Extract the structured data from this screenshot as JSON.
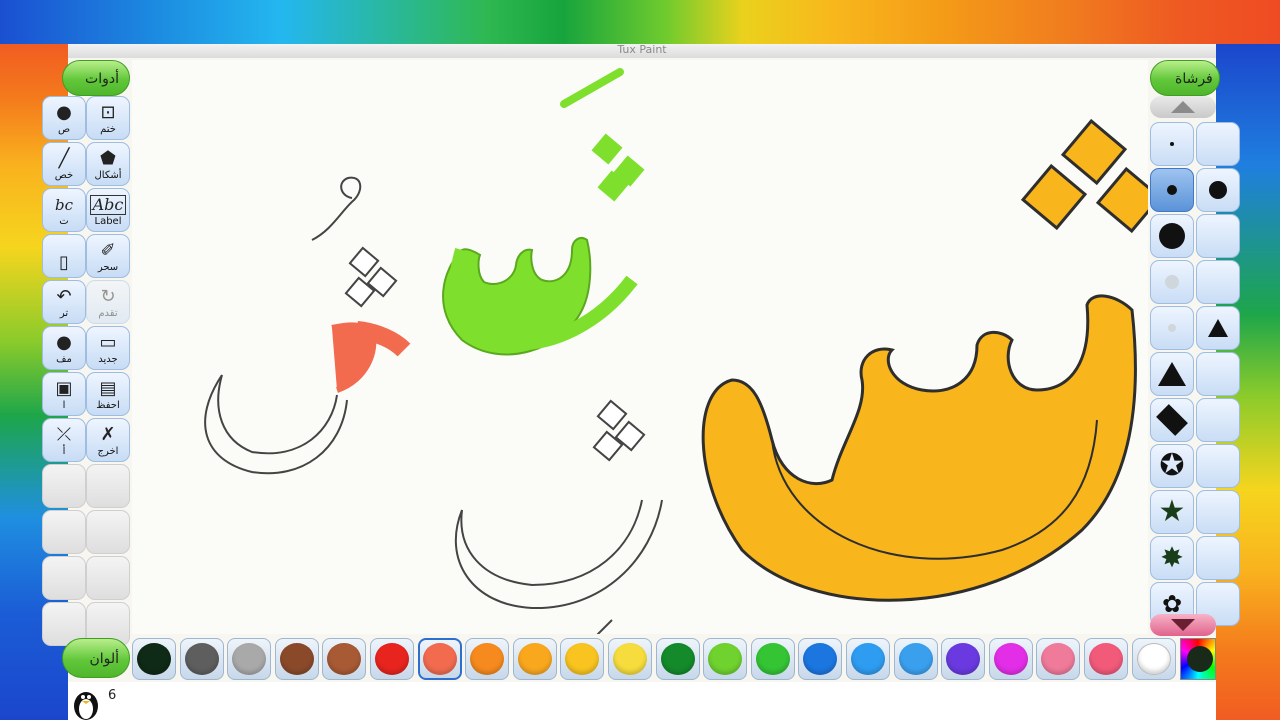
{
  "window": {
    "title": "Tux Paint"
  },
  "tools_panel": {
    "header": "أدوات",
    "tools": [
      {
        "label": "ختم",
        "icon": "stamp-icon",
        "glyph": "⊡",
        "enabled": true
      },
      {
        "label": "أشكال",
        "icon": "shapes-icon",
        "glyph": "⬟",
        "enabled": true
      },
      {
        "label": "Label",
        "icon": "label-icon",
        "glyph": "Abc",
        "enabled": true
      },
      {
        "label": "سحر",
        "icon": "magic-icon",
        "glyph": "✐",
        "enabled": true
      },
      {
        "label": "تقدم",
        "icon": "redo-icon",
        "glyph": "↻",
        "enabled": false
      },
      {
        "label": "جديد",
        "icon": "new-icon",
        "glyph": "▭",
        "enabled": true
      },
      {
        "label": "احفظ",
        "icon": "save-icon",
        "glyph": "▤",
        "enabled": true
      },
      {
        "label": "اخرج",
        "icon": "quit-icon",
        "glyph": "✗",
        "enabled": true
      }
    ],
    "left_column_fragments": [
      {
        "label": "ص",
        "icon": "paint-icon"
      },
      {
        "label": "خص",
        "icon": "lines-icon"
      },
      {
        "label": "ت",
        "icon": "text-icon"
      },
      {
        "label": "",
        "icon": "eraser-icon"
      },
      {
        "label": "تر",
        "icon": "undo-icon"
      },
      {
        "label": "مف",
        "icon": "open-icon"
      },
      {
        "label": "ا",
        "icon": "print-icon"
      },
      {
        "label": "أ",
        "icon": "exit-icon"
      }
    ]
  },
  "brush_panel": {
    "header": "فرشاة",
    "scroll_up": "scroll-up-arrow",
    "scroll_down": "scroll-down-arrow",
    "brushes": [
      {
        "icon": "brush-tiny-dot",
        "selected": false
      },
      {
        "icon": "brush-small-dot",
        "selected": true
      },
      {
        "icon": "brush-large-dot",
        "selected": false
      },
      {
        "icon": "brush-soft-dot",
        "selected": false
      },
      {
        "icon": "brush-faint-dot",
        "selected": false
      },
      {
        "icon": "brush-triangle",
        "selected": false
      },
      {
        "icon": "brush-diamond",
        "selected": false
      },
      {
        "icon": "brush-star-outline",
        "selected": false
      },
      {
        "icon": "brush-star",
        "selected": false
      },
      {
        "icon": "brush-star-burst",
        "selected": false
      },
      {
        "icon": "brush-flower",
        "selected": false
      }
    ]
  },
  "colors_panel": {
    "header": "ألوان",
    "swatches": [
      {
        "hex": "#0f2a16",
        "selected": false
      },
      {
        "hex": "#5e5e5e",
        "selected": false
      },
      {
        "hex": "#a9a9a9",
        "selected": false
      },
      {
        "hex": "#8a4a2a",
        "selected": false
      },
      {
        "hex": "#a85a34",
        "selected": false
      },
      {
        "hex": "#e8241e",
        "selected": false
      },
      {
        "hex": "#f26b4f",
        "selected": true
      },
      {
        "hex": "#f68a1e",
        "selected": false
      },
      {
        "hex": "#f9a81e",
        "selected": false
      },
      {
        "hex": "#f9c41f",
        "selected": false
      },
      {
        "hex": "#f6dc3c",
        "selected": false
      },
      {
        "hex": "#148a2a",
        "selected": false
      },
      {
        "hex": "#6fd22e",
        "selected": false
      },
      {
        "hex": "#34c434",
        "selected": false
      },
      {
        "hex": "#1b76e0",
        "selected": false
      },
      {
        "hex": "#2e9cf0",
        "selected": false
      },
      {
        "hex": "#3aa0ee",
        "selected": false
      },
      {
        "hex": "#6a3ae0",
        "selected": false
      },
      {
        "hex": "#e22ee6",
        "selected": false
      },
      {
        "hex": "#f07a9a",
        "selected": false
      },
      {
        "hex": "#f25a7a",
        "selected": false
      },
      {
        "hex": "#ffffff",
        "selected": false
      }
    ],
    "custom_picker": "color-picker"
  },
  "canvas": {
    "letters": [
      {
        "char": "ش",
        "role": "large-yellow-filled",
        "color": "#f8b51c"
      },
      {
        "char": "شَ",
        "role": "green-filled",
        "color": "#7ee02c"
      },
      {
        "char": "شُ",
        "role": "outline-with-damma",
        "color": "#ffffff"
      },
      {
        "char": "شِ",
        "role": "outline-with-kasra",
        "color": "#ffffff"
      }
    ],
    "paint_splotch_color": "#f26b4f"
  },
  "status": {
    "text": "6"
  }
}
